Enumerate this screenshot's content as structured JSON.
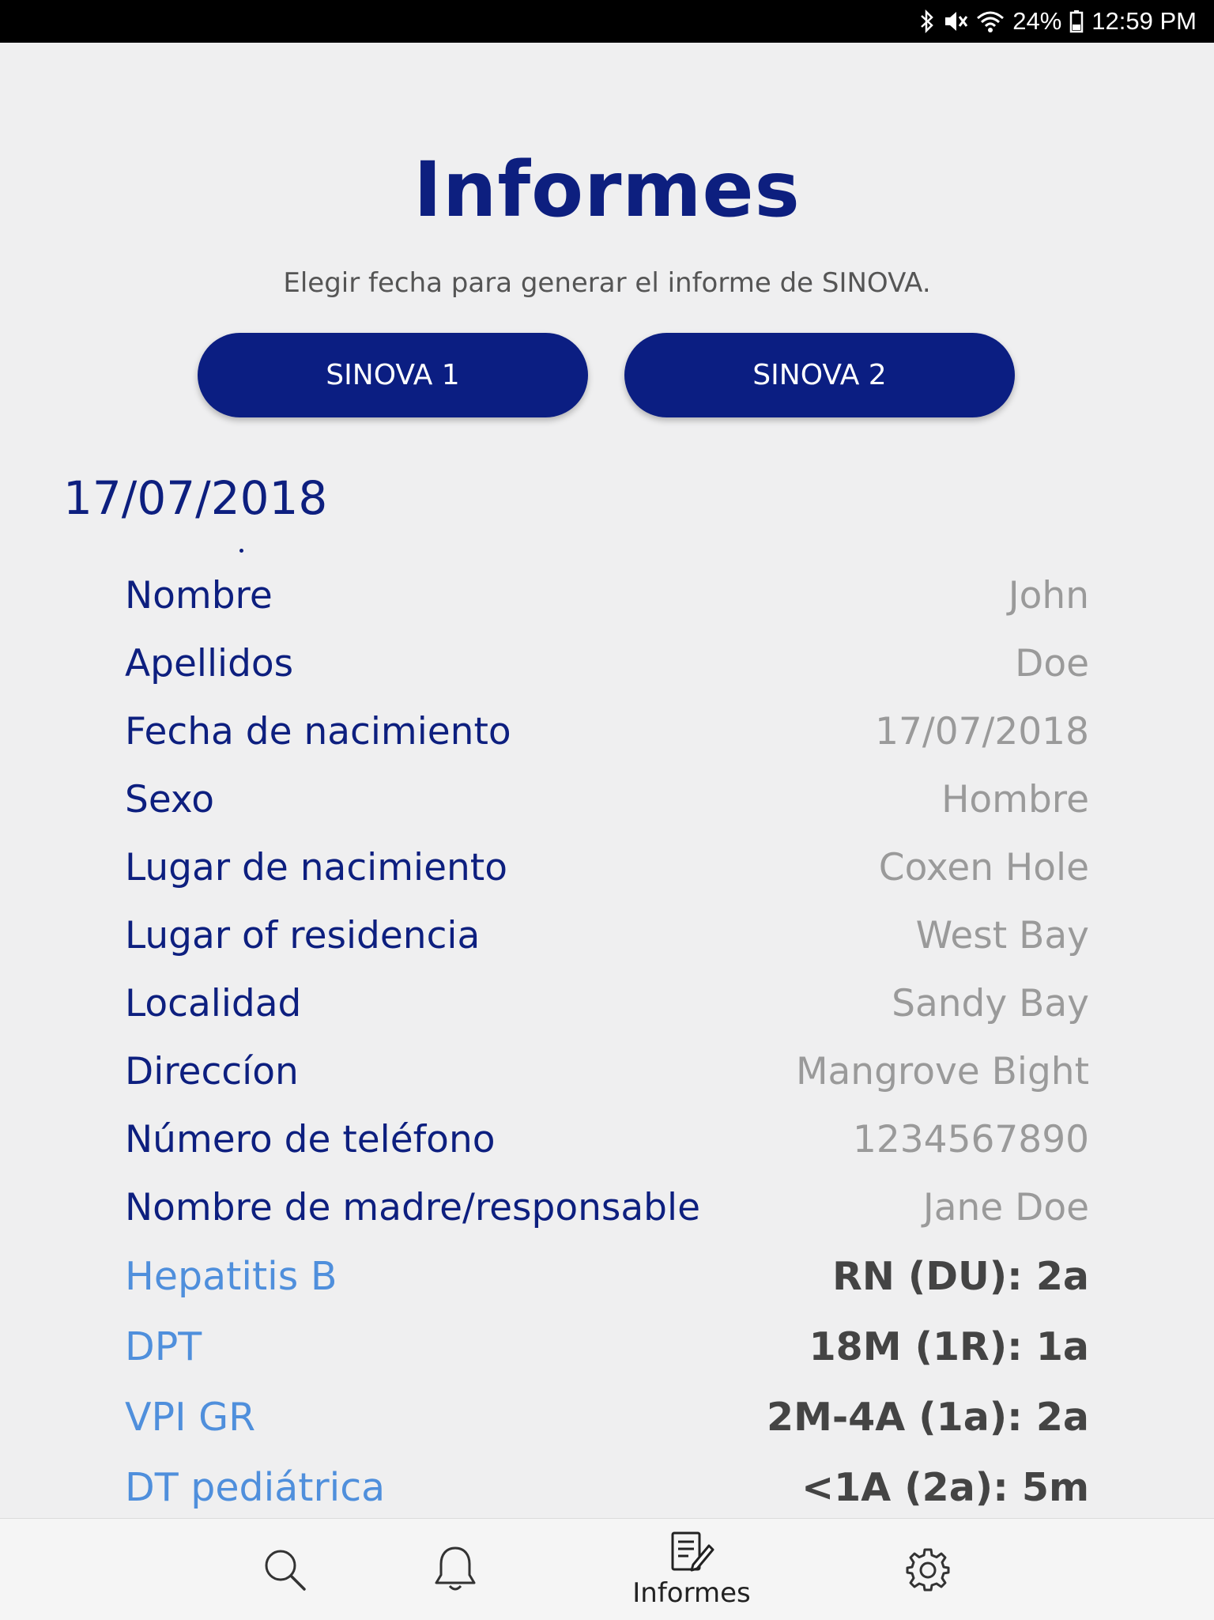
{
  "status_bar": {
    "battery": "24%",
    "time": "12:59 PM"
  },
  "header": {
    "title": "Informes",
    "subtitle": "Elegir fecha para generar el informe de SINOVA."
  },
  "buttons": {
    "sinova1": "SINOVA 1",
    "sinova2": "SINOVA 2"
  },
  "report": {
    "date": "17/07/2018",
    "fields": [
      {
        "label": "Nombre",
        "value": "John"
      },
      {
        "label": "Apellidos",
        "value": "Doe"
      },
      {
        "label": "Fecha de nacimiento",
        "value": "17/07/2018"
      },
      {
        "label": "Sexo",
        "value": "Hombre"
      },
      {
        "label": "Lugar de nacimiento",
        "value": "Coxen Hole"
      },
      {
        "label": "Lugar of residencia",
        "value": "West Bay"
      },
      {
        "label": "Localidad",
        "value": "Sandy Bay"
      },
      {
        "label": "Direccíon",
        "value": "Mangrove Bight"
      },
      {
        "label": "Número de teléfono",
        "value": "1234567890"
      },
      {
        "label": "Nombre de madre/responsable",
        "value": "Jane Doe"
      }
    ],
    "vaccines": [
      {
        "label": "Hepatitis B",
        "value": "RN (DU): 2a"
      },
      {
        "label": "DPT",
        "value": "18M (1R): 1a"
      },
      {
        "label": "VPI GR",
        "value": "2M-4A (1a): 2a"
      },
      {
        "label": "DT pediátrica",
        "value": "<1A (2a): 5m"
      }
    ]
  },
  "tab_bar": {
    "items": [
      {
        "icon": "search-icon",
        "label": ""
      },
      {
        "icon": "bell-icon",
        "label": ""
      },
      {
        "icon": "report-icon",
        "label": "Informes"
      },
      {
        "icon": "gear-icon",
        "label": ""
      }
    ]
  }
}
